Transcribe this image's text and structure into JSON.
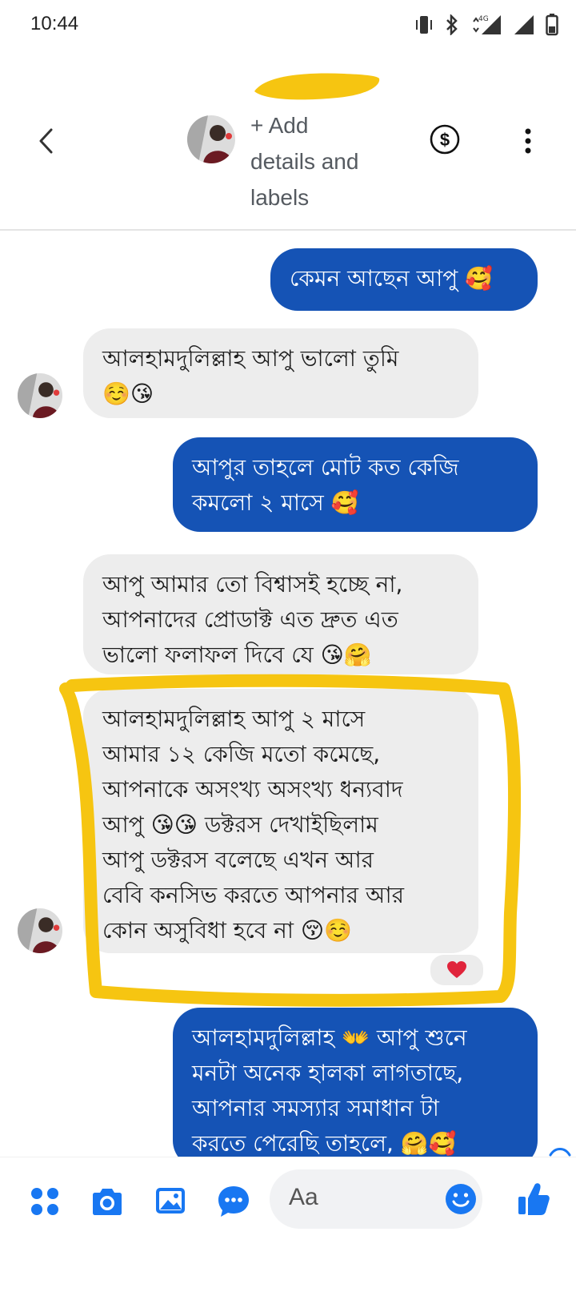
{
  "status_bar": {
    "time": "10:44",
    "network": "4G"
  },
  "header": {
    "details_lines": [
      "+ Add",
      "details and",
      "labels"
    ],
    "back_icon": "chevron-left-icon",
    "payment_icon": "dollar-circle-icon",
    "menu_icon": "vertical-dots-icon"
  },
  "messages": [
    {
      "side": "outgoing",
      "lines": [
        "কেমন আছেন আপু 🥰"
      ]
    },
    {
      "side": "incoming",
      "lines": [
        "আলহামদুলিল্লাহ আপু ভালো তুমি",
        "☺️😘"
      ]
    },
    {
      "side": "outgoing",
      "lines": [
        "আপুর তাহলে মোট কত কেজি",
        "কমলো ২ মাসে 🥰"
      ]
    },
    {
      "side": "incoming",
      "lines": [
        "আপু আমার তো বিশ্বাসই হচ্ছে না,",
        "আপনাদের প্রোডাক্ট এত দ্রুত এত",
        "ভালো ফলাফল দিবে যে 😘🤗"
      ]
    },
    {
      "side": "incoming",
      "lines": [
        "আলহামদুলিল্লাহ আপু ২ মাসে",
        "আমার ১২ কেজি মতো কমেছে,",
        "আপনাকে অসংখ্য অসংখ্য ধন্যবাদ",
        "আপু  😘😘 ডক্টরস দেখাইছিলাম",
        "আপু ডক্টরস বলেছে এখন আর",
        "বেবি কনসিভ করতে আপনার আর",
        "কোন অসুবিধা হবে না 😚☺️"
      ],
      "reaction": "❤️"
    },
    {
      "side": "outgoing",
      "lines": [
        "আলহামদুলিল্লাহ 👐 আপু শুনে",
        "মনটা অনেক হালকা লাগতাছে,",
        "আপনার সমস্যার সমাধান টা",
        "করতে পেরেছি তাহলে, 🤗🥰"
      ]
    }
  ],
  "composer": {
    "placeholder": "Aa",
    "tools": [
      "grid-menu-icon",
      "camera-icon",
      "gallery-icon",
      "chat-bubble-icon"
    ],
    "emoji_icon": "smiley-icon",
    "like_icon": "thumbs-up-icon"
  },
  "colors": {
    "outgoing_bubble": "#1553b5",
    "incoming_bubble": "#ededed",
    "accent": "#1877f2",
    "highlight": "#f6c511",
    "heart": "#e0243b"
  }
}
